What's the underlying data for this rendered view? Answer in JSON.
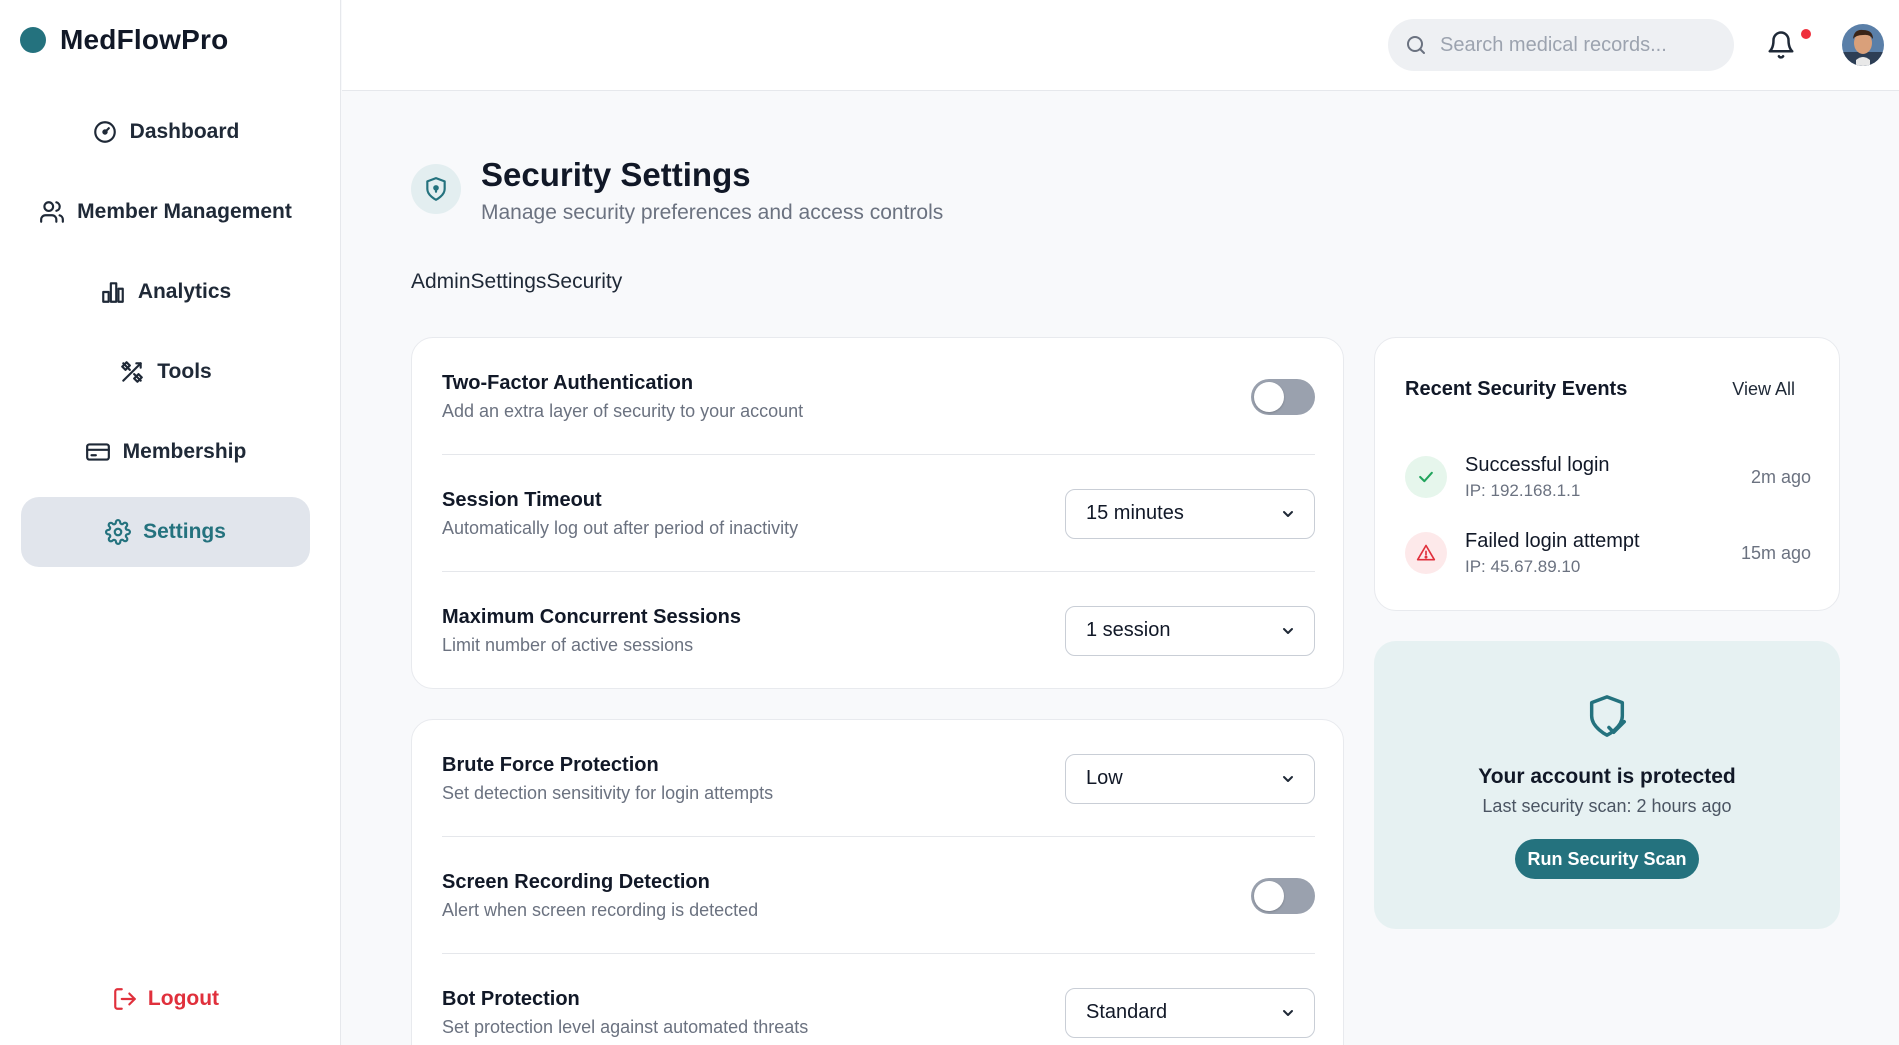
{
  "app": {
    "name": "MedFlowPro",
    "accent": "#24727e"
  },
  "sidebar": {
    "items": [
      {
        "label": "Dashboard",
        "icon": "gauge-icon"
      },
      {
        "label": "Member Management",
        "icon": "users-icon"
      },
      {
        "label": "Analytics",
        "icon": "bar-chart-icon"
      },
      {
        "label": "Tools",
        "icon": "tools-icon"
      },
      {
        "label": "Membership",
        "icon": "card-icon"
      },
      {
        "label": "Settings",
        "icon": "gear-icon",
        "active": true
      }
    ],
    "logout_label": "Logout"
  },
  "topbar": {
    "search_placeholder": "Search medical records...",
    "notification_dot": true
  },
  "page": {
    "title": "Security Settings",
    "subtitle": "Manage security preferences and access controls",
    "breadcrumb": "AdminSettingsSecurity"
  },
  "settings_group_1": {
    "two_factor": {
      "title": "Two-Factor Authentication",
      "desc": "Add an extra layer of security to your account",
      "enabled": false
    },
    "session_timeout": {
      "title": "Session Timeout",
      "desc": "Automatically log out after period of inactivity",
      "value": "15 minutes"
    },
    "max_sessions": {
      "title": "Maximum Concurrent Sessions",
      "desc": "Limit number of active sessions",
      "value": "1 session"
    }
  },
  "settings_group_2": {
    "brute_force": {
      "title": "Brute Force Protection",
      "desc": "Set detection sensitivity for login attempts",
      "value": "Low"
    },
    "screen_recording": {
      "title": "Screen Recording Detection",
      "desc": "Alert when screen recording is detected",
      "enabled": false
    },
    "bot_protection": {
      "title": "Bot Protection",
      "desc": "Set protection level against automated threats",
      "value": "Standard"
    }
  },
  "events": {
    "title": "Recent Security Events",
    "view_all": "View All",
    "items": [
      {
        "title": "Successful login",
        "ip": "IP: 192.168.1.1",
        "time": "2m ago",
        "status": "success"
      },
      {
        "title": "Failed login attempt",
        "ip": "IP: 45.67.89.10",
        "time": "15m ago",
        "status": "warning"
      }
    ]
  },
  "protection": {
    "title": "Your account is protected",
    "subtitle": "Last security scan: 2 hours ago",
    "button": "Run Security Scan"
  }
}
